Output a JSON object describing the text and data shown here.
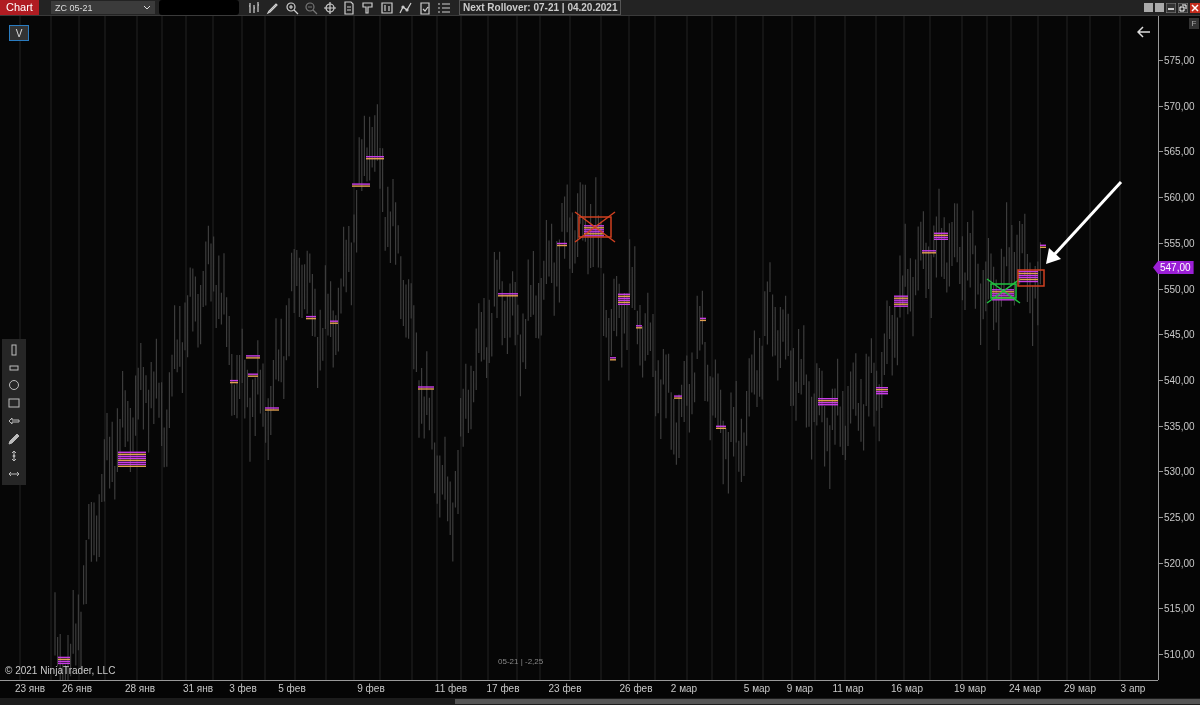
{
  "toolbar": {
    "tab": "Chart",
    "instrument": "ZC 05-21",
    "rollover": "Next Rollover: 07-21 | 04.20.2021"
  },
  "chart": {
    "indicator_button": "V",
    "corner_button": "F",
    "price_axis": [
      "575,00",
      "570,00",
      "565,00",
      "560,00",
      "555,00",
      "550,00",
      "545,00",
      "540,00",
      "535,00",
      "530,00",
      "525,00",
      "520,00",
      "515,00",
      "510,00"
    ],
    "current_price": "547,00",
    "date_axis": [
      "23 янв",
      "26 янв",
      "28 янв",
      "31 янв",
      "3 фев",
      "5 фев",
      "9 фев",
      "11 фев",
      "17 фев",
      "23 фев",
      "26 фев",
      "2 мар",
      "5 мар",
      "9 мар",
      "11 мар",
      "16 мар",
      "19 мар",
      "24 мар",
      "29 мар",
      "3 апр"
    ],
    "copyright": "© 2021 NinjaTrader, LLC",
    "contract_label": "05-21 | -2,25"
  }
}
